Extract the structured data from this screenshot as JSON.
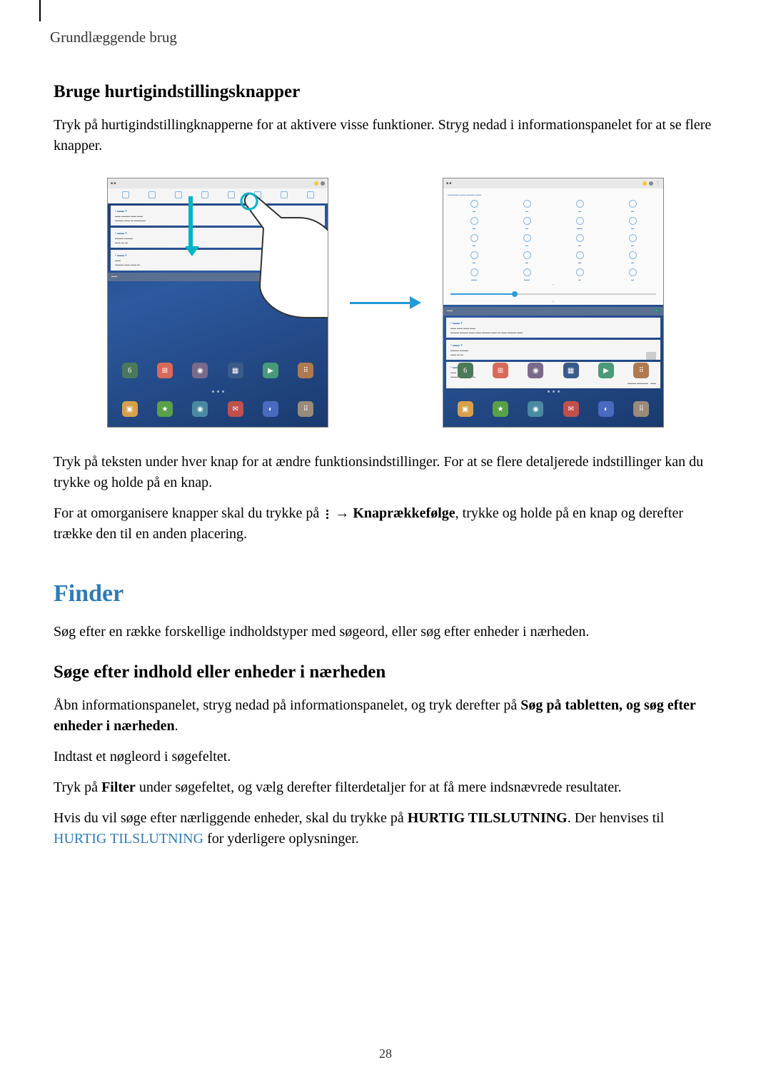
{
  "header": {
    "section": "Grundlæggende brug"
  },
  "s1": {
    "heading": "Bruge hurtigindstillingsknapper",
    "p1": "Tryk på hurtigindstillingknapperne for at aktivere visse funktioner. Stryg nedad i informationspanelet for at se flere knapper.",
    "p2": "Tryk på teksten under hver knap for at ændre funktionsindstillinger. For at se flere detaljerede indstillinger kan du trykke og holde på en knap.",
    "p3a": "For at omorganisere knapper skal du trykke på ",
    "p3_arrow": " → ",
    "p3_bold": "Knaprækkefølge",
    "p3b": ", trykke og holde på en knap og derefter trække den til en anden placering."
  },
  "s2": {
    "heading": "Finder",
    "p1": "Søg efter en række forskellige indholdstyper med søgeord, eller søg efter enheder i nærheden.",
    "sub": "Søge efter indhold eller enheder i nærheden",
    "p2a": "Åbn informationspanelet, stryg nedad på informationspanelet, og tryk derefter på ",
    "p2_bold": "Søg på tabletten, og søg efter enheder i nærheden",
    "p2b": ".",
    "p3": "Indtast et nøgleord i søgefeltet.",
    "p4a": "Tryk på ",
    "p4_bold": "Filter",
    "p4b": " under søgefeltet, og vælg derefter filterdetaljer for at få mere indsnævrede resultater.",
    "p5a": "Hvis du vil søge efter nærliggende enheder, skal du trykke på ",
    "p5_bold": "HURTIG TILSLUTNING",
    "p5b": ". Der henvises til ",
    "p5_link": "HURTIG TILSLUTNING",
    "p5c": " for yderligere oplysninger."
  },
  "page_number": "28"
}
